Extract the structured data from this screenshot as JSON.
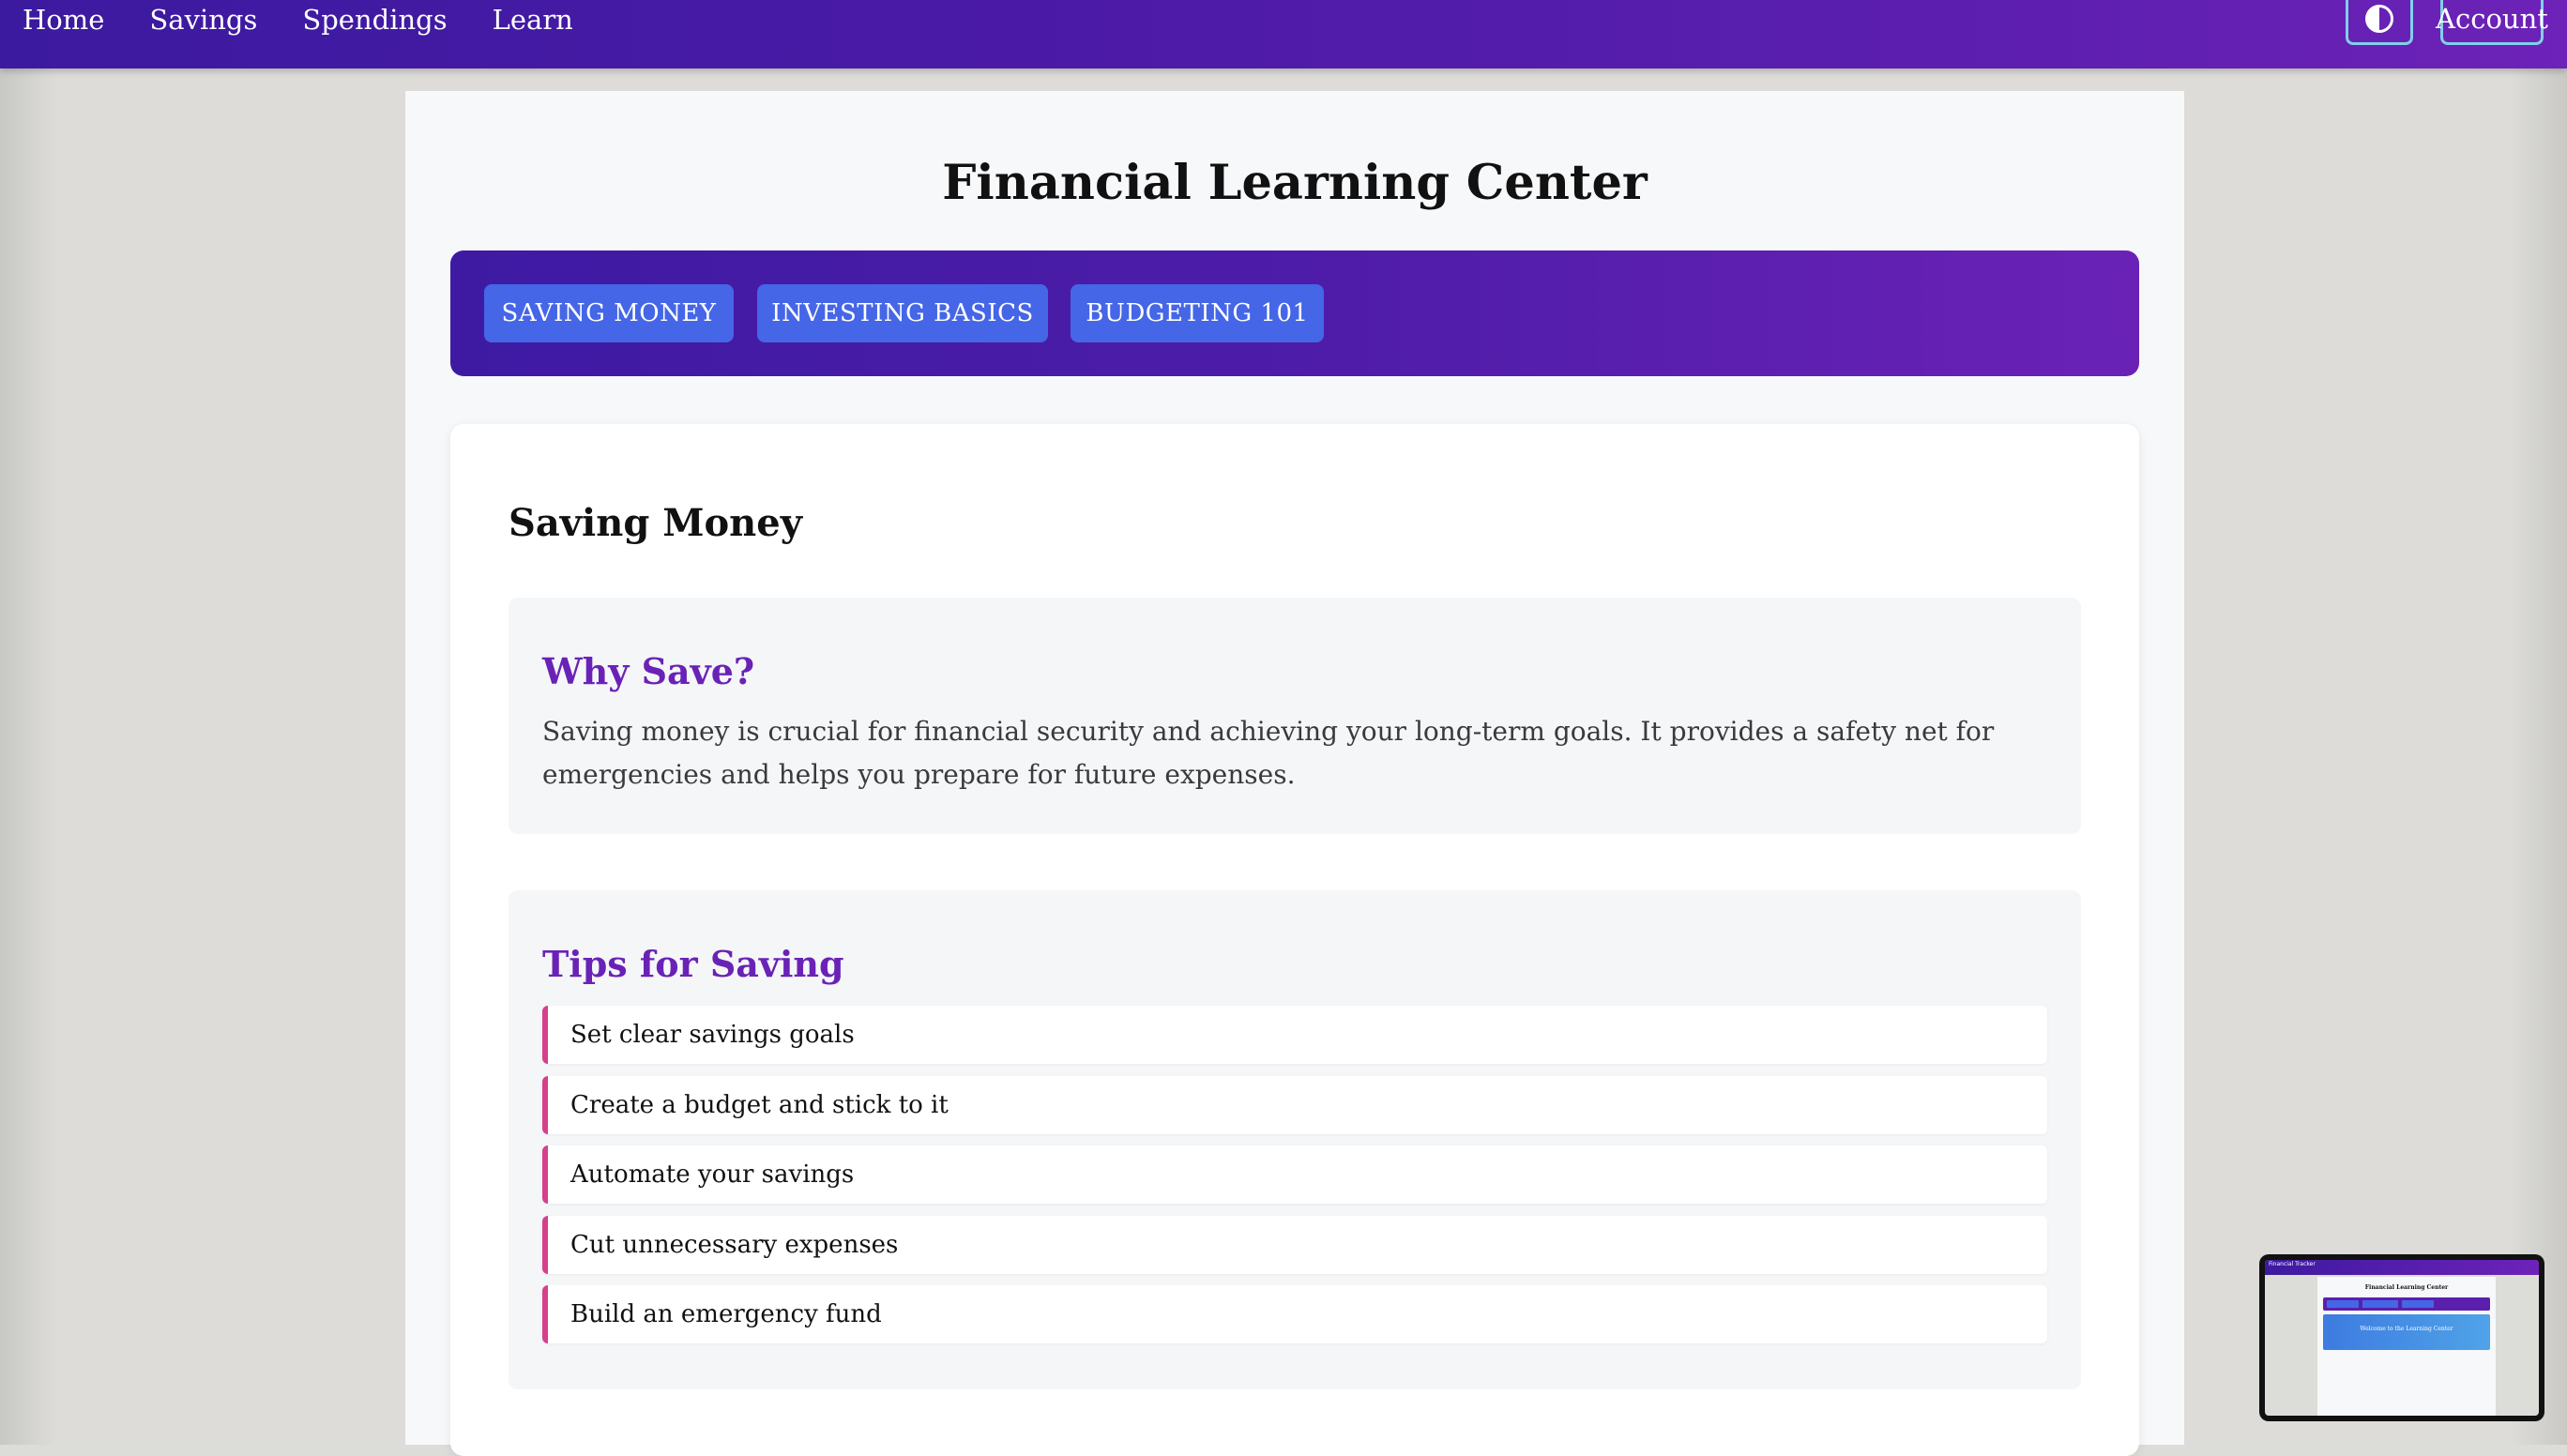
{
  "nav": {
    "links": [
      "Home",
      "Savings",
      "Spendings",
      "Learn"
    ],
    "account_label": "Account",
    "theme_icon": "contrast-icon"
  },
  "page": {
    "title": "Financial Learning Center"
  },
  "tabs": [
    "SAVING MONEY",
    "INVESTING BASICS",
    "BUDGETING 101"
  ],
  "content": {
    "heading": "Saving Money",
    "why_save": {
      "title": "Why Save?",
      "text": "Saving money is crucial for financial security and achieving your long-term goals. It provides a safety net for emergencies and helps you prepare for future expenses."
    },
    "tips": {
      "title": "Tips for Saving",
      "items": [
        "Set clear savings goals",
        "Create a budget and stick to it",
        "Automate your savings",
        "Cut unnecessary expenses",
        "Build an emergency fund"
      ]
    }
  },
  "thumbnail": {
    "brand": "Financial Tracker",
    "title": "Financial Learning Center",
    "hero": "Welcome to the Learning Center"
  },
  "colors": {
    "nav_gradient_start": "#3c1aa0",
    "nav_gradient_end": "#6d22b8",
    "tab_button": "#4566e6",
    "section_title": "#6a22b6",
    "tip_accent": "#d63f8c",
    "button_border": "#7fd0e8"
  }
}
